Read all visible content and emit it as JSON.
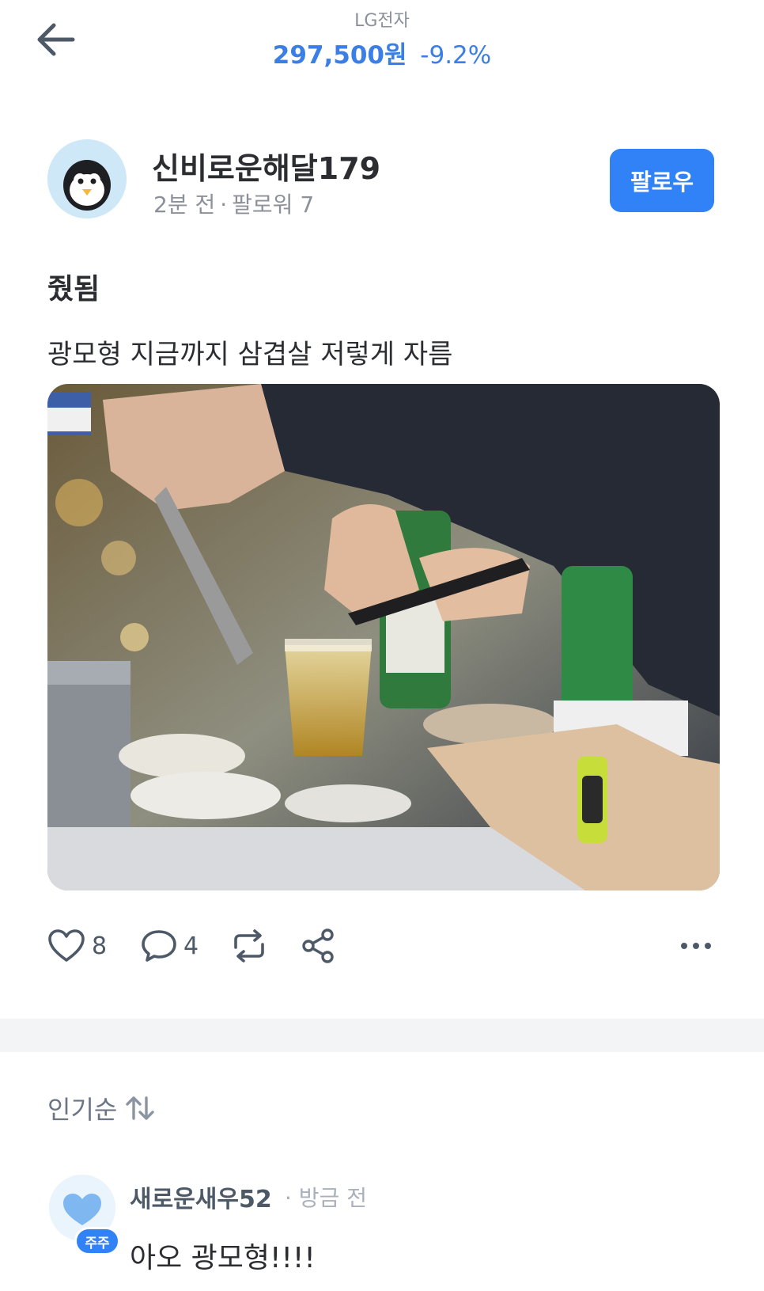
{
  "header": {
    "back_icon": "arrow-left-icon",
    "stock_name": "LG전자",
    "stock_price": "297,500원",
    "stock_change": "-9.2%",
    "accent_color": "#3a7ee6"
  },
  "author": {
    "avatar_icon": "penguin-avatar",
    "name": "신비로운해달179",
    "time": "2분 전",
    "followers": "팔로워 7",
    "follow_label": "팔로우"
  },
  "post": {
    "title": "줬됨",
    "body": "광모형 지금까지 삼겹살 저렇게 자름",
    "image_description_icon": "photo-image"
  },
  "actions": {
    "like_icon": "heart-icon",
    "like_count": "8",
    "comment_icon": "comment-bubble-icon",
    "comment_count": "4",
    "repost_icon": "repost-icon",
    "share_icon": "share-icon",
    "more_icon": "more-dots-icon"
  },
  "comments": {
    "sort_label": "인기순",
    "sort_icon": "sort-arrows-icon",
    "items": [
      {
        "name": "새로운새우52",
        "time": "· 방금 전",
        "badge": "주주",
        "text": "아오 광모형!!!!"
      }
    ]
  }
}
